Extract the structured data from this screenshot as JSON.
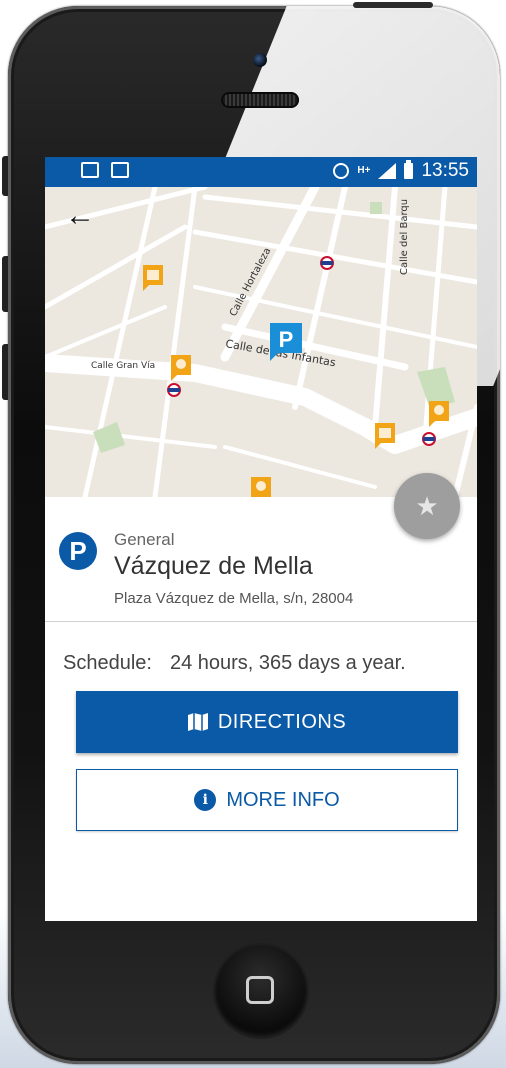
{
  "status_bar": {
    "time": "13:55",
    "network": "H+",
    "icons": [
      "notification-icon",
      "image-icon",
      "alarm-icon",
      "signal-icon",
      "battery-icon"
    ]
  },
  "map": {
    "streets": [
      "Calle Hortaleza",
      "Calle de las Infantas",
      "Calle Gran Vía",
      "Calle del Barqu"
    ],
    "parking_marker": "P"
  },
  "place": {
    "category": "General",
    "name": "Vázquez de Mella",
    "address": "Plaza Vázquez de Mella, s/n, 28004",
    "badge": "P"
  },
  "schedule": {
    "label": "Schedule:",
    "value": "24 hours, 365 days a year."
  },
  "buttons": {
    "directions": "DIRECTIONS",
    "more_info": "MORE INFO"
  },
  "colors": {
    "primary": "#0a5aa7",
    "fab": "#9e9e9e",
    "map_bg": "#ece7df",
    "poi_orange": "#f2a417"
  }
}
